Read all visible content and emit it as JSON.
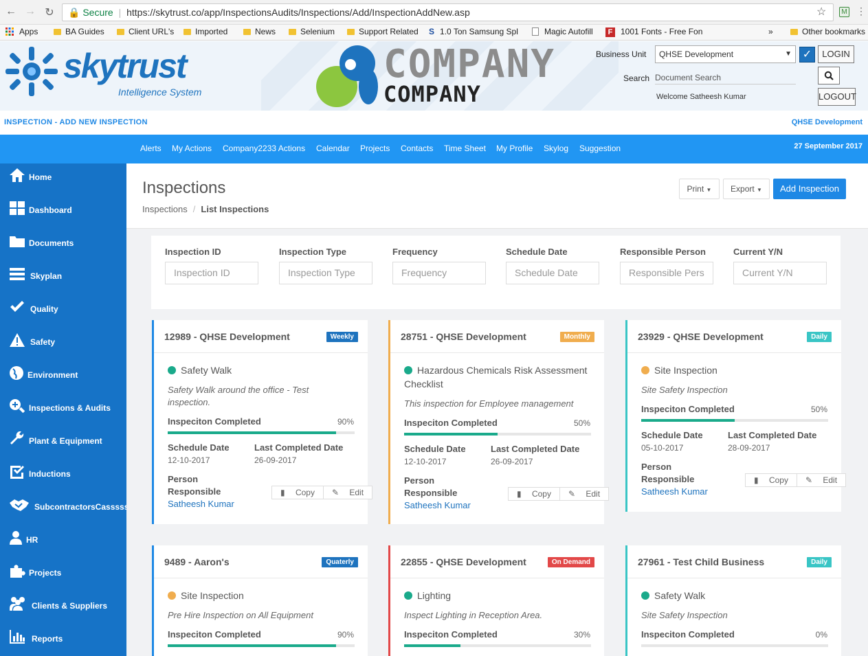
{
  "browser": {
    "secure_label": "Secure",
    "url": "https://skytrust.co/app/InspectionsAudits/Inspections/Add/InspectionAddNew.asp",
    "bookmarks": [
      "Apps",
      "BA Guides",
      "Client URL's",
      "Imported",
      "News",
      "Selenium",
      "Support Related",
      "1.0 Ton Samsung Spl",
      "Magic Autofill",
      "1001 Fonts - Free Fon",
      "Other bookmarks"
    ],
    "bookmarks_overflow": "»"
  },
  "header": {
    "logo_text": "skytrust",
    "logo_sub": "Intelligence System",
    "company_line1": "COMPANY",
    "company_line2": "COMPANY",
    "business_unit_label": "Business Unit",
    "business_unit_value": "QHSE Development",
    "login_label": "LOGIN",
    "search_label": "Search",
    "search_placeholder": "Document Search",
    "welcome": "Welcome Satheesh Kumar",
    "logout_label": "LOGOUT"
  },
  "strip": {
    "left": "INSPECTION - ADD NEW INSPECTION",
    "right": "QHSE Development"
  },
  "topnav": {
    "items": [
      "Alerts",
      "My Actions",
      "Company2233 Actions",
      "Calendar",
      "Projects",
      "Contacts",
      "Time Sheet",
      "My Profile",
      "Skylog",
      "Suggestion"
    ],
    "date": "27 September 2017"
  },
  "sidebar": {
    "items": [
      "Home",
      "Dashboard",
      "Documents",
      "Skyplan",
      "Quality",
      "Safety",
      "Environment",
      "Inspections & Audits",
      "Plant & Equipment",
      "Inductions",
      "SubcontractorsCasssss",
      "HR",
      "Projects",
      "Clients & Suppliers",
      "Reports"
    ]
  },
  "page": {
    "title": "Inspections",
    "breadcrumb_root": "Inspections",
    "breadcrumb_sep": "/",
    "breadcrumb_current": "List Inspections",
    "print_label": "Print",
    "export_label": "Export",
    "add_label": "Add Inspection"
  },
  "filters": [
    {
      "label": "Inspection ID",
      "placeholder": "Inspection ID"
    },
    {
      "label": "Inspection Type",
      "placeholder": "Inspection Type"
    },
    {
      "label": "Frequency",
      "placeholder": "Frequency"
    },
    {
      "label": "Schedule Date",
      "placeholder": "Schedule Date"
    },
    {
      "label": "Responsible Person",
      "placeholder": "Responsible Pers"
    },
    {
      "label": "Current Y/N",
      "placeholder": "Current Y/N"
    }
  ],
  "labels": {
    "completed": "Inspeciton Completed",
    "schedule": "Schedule Date",
    "last_completed": "Last Completed Date",
    "person": "Person",
    "responsible": "Responsible",
    "copy": "Copy",
    "edit": "Edit"
  },
  "cards": [
    {
      "head": "12989 - QHSE Development",
      "badge": "Weekly",
      "badge_color": "#1e73be",
      "accent": "#1e88e5",
      "status_color": "#1aaa8b",
      "title": "Safety Walk",
      "desc": "Safety Walk around the office - Test inspection.",
      "progress": 90,
      "progress_label": "90%",
      "schedule": "12-10-2017",
      "last": "26-09-2017",
      "person": "Satheesh Kumar"
    },
    {
      "head": "28751 - QHSE Development",
      "badge": "Monthly",
      "badge_color": "#f0ad4e",
      "accent": "#f0ad4e",
      "status_color": "#1aaa8b",
      "title": "Hazardous Chemicals Risk Assessment Checklist",
      "desc": "This inspection for Employee management",
      "progress": 50,
      "progress_label": "50%",
      "schedule": "12-10-2017",
      "last": "26-09-2017",
      "person": "Satheesh Kumar"
    },
    {
      "head": "23929 - QHSE Development",
      "badge": "Daily",
      "badge_color": "#39c5c5",
      "accent": "#39c5c5",
      "status_color": "#f0ad4e",
      "title": "Site Inspection",
      "desc": "Site Safety Inspection",
      "progress": 50,
      "progress_label": "50%",
      "schedule": "05-10-2017",
      "last": "28-09-2017",
      "person": "Satheesh Kumar"
    },
    {
      "head": "9489 - Aaron's",
      "badge": "Quaterly",
      "badge_color": "#1e73be",
      "accent": "#1e88e5",
      "status_color": "#f0ad4e",
      "title": "Site Inspection",
      "desc": "Pre Hire Inspection on All Equipment",
      "progress": 90,
      "progress_label": "90%"
    },
    {
      "head": "22855 - QHSE Development",
      "badge": "On Demand",
      "badge_color": "#e24848",
      "accent": "#e24848",
      "status_color": "#1aaa8b",
      "title": "Lighting",
      "desc": "Inspect Lighting in Reception Area.",
      "progress": 30,
      "progress_label": "30%"
    },
    {
      "head": "27961 - Test Child Business",
      "badge": "Daily",
      "badge_color": "#39c5c5",
      "accent": "#39c5c5",
      "status_color": "#1aaa8b",
      "title": "Safety Walk",
      "desc": "Site Safety Inspection",
      "progress": 0,
      "progress_label": "0%"
    }
  ]
}
